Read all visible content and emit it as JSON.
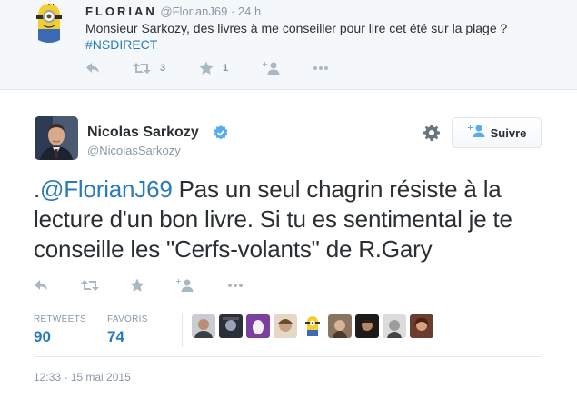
{
  "parent_tweet": {
    "name": "FLORIAN",
    "handle": "@FlorianJ69",
    "separator": "·",
    "time": "24 h",
    "text_line1": "Monsieur Sarkozy, des livres à me conseiller pour lire cet été sur la plage ?",
    "hashtag": "#NSDIRECT",
    "retweet_count": "3",
    "favorite_count": "1"
  },
  "main_tweet": {
    "name": "Nicolas Sarkozy",
    "handle": "@NicolasSarkozy",
    "follow_label": "Suivre",
    "text_prefix": ".",
    "mention": "@FlorianJ69",
    "text_body": " Pas un seul chagrin résiste à la lecture d'un bon livre. Si tu es sentimental je te conseille les \"Cerfs-volants\" de R.Gary",
    "stats": {
      "retweets_label": "RETWEETS",
      "retweets_value": "90",
      "favorites_label": "FAVORIS",
      "favorites_value": "74"
    },
    "timestamp": "12:33 - 15 mai 2015"
  },
  "colors": {
    "link": "#2b7bb9",
    "muted": "#8899a6",
    "icon": "#aab8c2",
    "verified": "#55acee"
  },
  "icons": [
    "reply-icon",
    "retweet-icon",
    "favorite-icon",
    "follow-icon",
    "more-icon",
    "gear-icon",
    "verified-icon",
    "add-user-icon"
  ]
}
